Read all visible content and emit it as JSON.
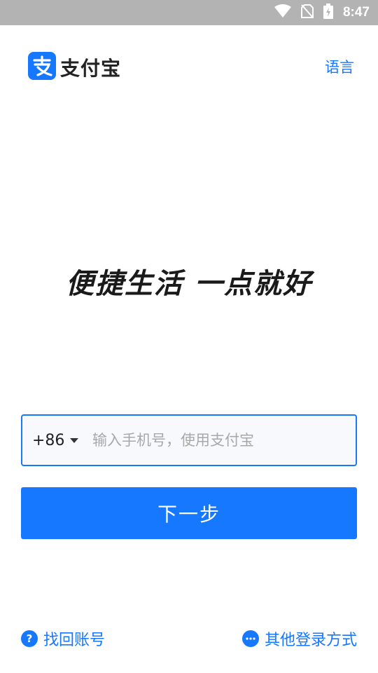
{
  "status_bar": {
    "time": "8:47"
  },
  "header": {
    "logo_text": "支付宝",
    "language_link": "语言"
  },
  "main": {
    "slogan": "便捷生活 一点就好",
    "country_code": "+86",
    "phone_placeholder": "输入手机号，使用支付宝",
    "next_button": "下一步"
  },
  "footer": {
    "recover_account": "找回账号",
    "other_login": "其他登录方式"
  },
  "colors": {
    "accent": "#1677ff",
    "status_bar": "#b3b3b3"
  }
}
